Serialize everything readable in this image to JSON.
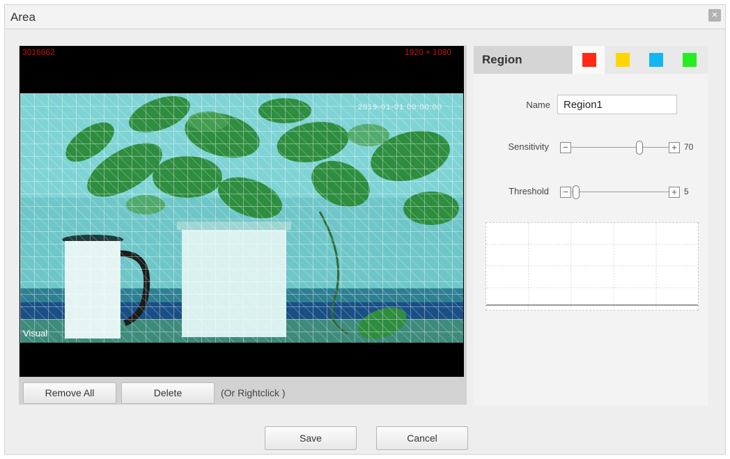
{
  "dialog": {
    "title": "Area",
    "close_glyph": "×"
  },
  "video": {
    "overlay_left": "3016662",
    "overlay_right": "1920 × 1080",
    "timestamp": "2019-01-01 00:00:00",
    "channel_label": "Visual",
    "grid_color": "#ffffff"
  },
  "video_controls": {
    "remove_all_label": "Remove All",
    "delete_label": "Delete",
    "hint": "(Or Rightclick )"
  },
  "region": {
    "title": "Region",
    "colors": [
      {
        "name": "red",
        "hex": "#ff2a16"
      },
      {
        "name": "yellow",
        "hex": "#ffd600"
      },
      {
        "name": "blue",
        "hex": "#13b6f0"
      },
      {
        "name": "green",
        "hex": "#26ee20"
      }
    ],
    "name_label": "Name",
    "name_value": "Region1",
    "sensitivity_label": "Sensitivity",
    "sensitivity_value": "70",
    "sensitivity_fraction": 0.7,
    "threshold_label": "Threshold",
    "threshold_value": "5",
    "threshold_fraction": 0.05,
    "minus_glyph": "−",
    "plus_glyph": "+"
  },
  "footer": {
    "save_label": "Save",
    "cancel_label": "Cancel"
  }
}
